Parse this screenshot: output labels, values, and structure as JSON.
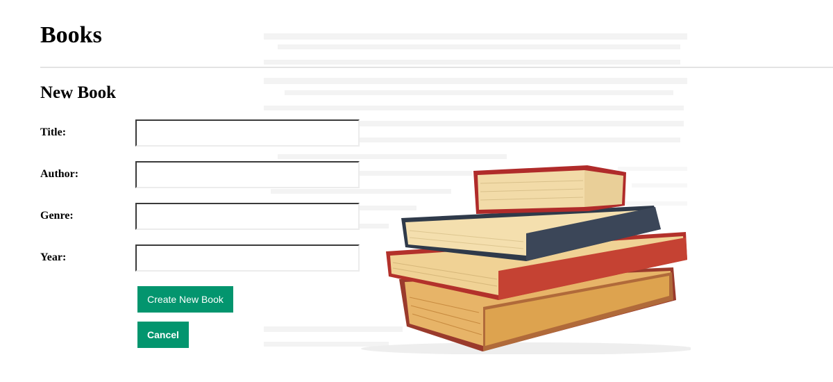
{
  "page": {
    "title": "Books",
    "section_title": "New Book"
  },
  "form": {
    "fields": [
      {
        "label": "Title:",
        "value": "",
        "placeholder": ""
      },
      {
        "label": "Author:",
        "value": "",
        "placeholder": ""
      },
      {
        "label": "Genre:",
        "value": "",
        "placeholder": ""
      },
      {
        "label": "Year:",
        "value": "",
        "placeholder": ""
      }
    ],
    "submit_label": "Create New Book",
    "cancel_label": "Cancel"
  },
  "colors": {
    "button": "#03956e",
    "divider": "#e3e3e3"
  },
  "images": {
    "hero": "stacked-books-image"
  }
}
